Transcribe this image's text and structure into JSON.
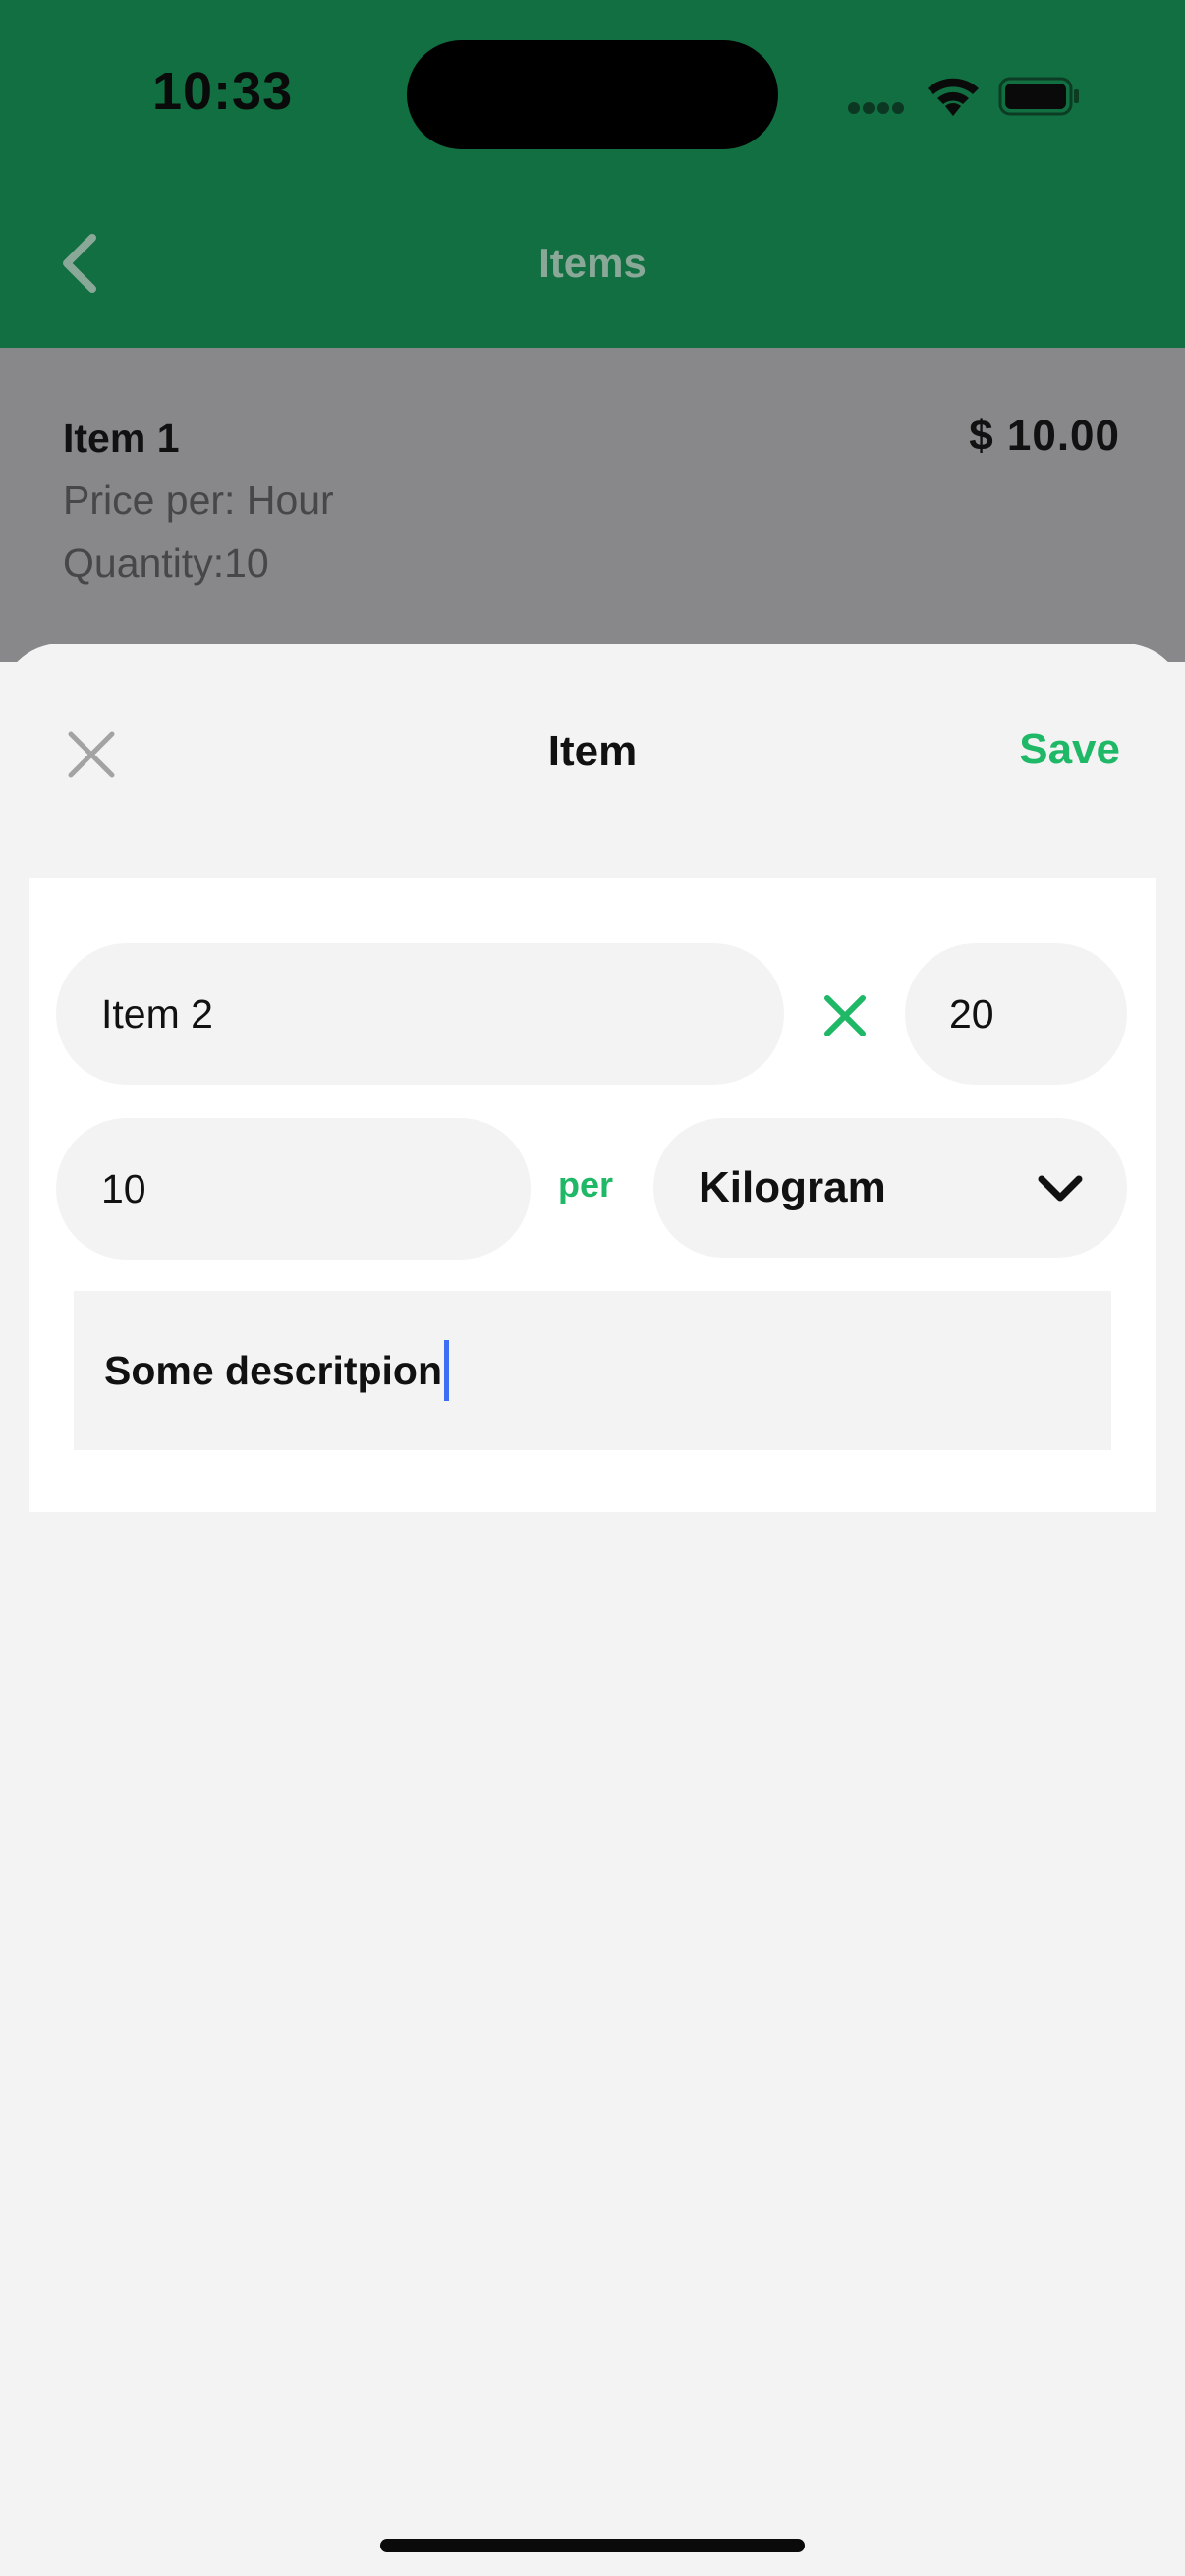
{
  "status_bar": {
    "time": "10:33",
    "icons": [
      "signal-dots-icon",
      "wifi-icon",
      "battery-icon"
    ]
  },
  "nav": {
    "title": "Items",
    "back_icon": "chevron-left-icon"
  },
  "list": {
    "items": [
      {
        "name": "Item 1",
        "price": "$ 10.00",
        "price_per": "Price per: Hour",
        "quantity": "Quantity:10"
      }
    ]
  },
  "sheet": {
    "title": "Item",
    "save_label": "Save",
    "close_icon": "close-icon"
  },
  "form": {
    "name_value": "Item 2",
    "multiply_icon": "multiply-icon",
    "quantity_value": "20",
    "price_value": "10",
    "per_label": "per",
    "unit_value": "Kilogram",
    "description_value": "Some descritpion"
  },
  "colors": {
    "header": "#116f41",
    "accent": "#1fb866",
    "cursor": "#3b6ef5",
    "field_bg": "#f3f3f3"
  }
}
